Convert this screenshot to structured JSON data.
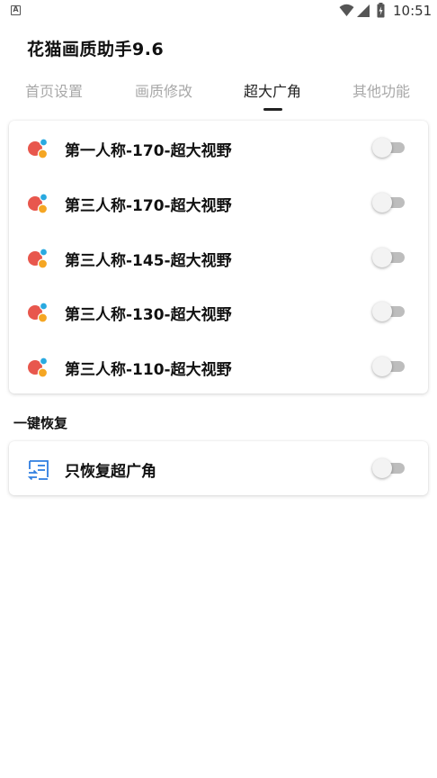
{
  "status_bar": {
    "notification_icon": "a-notification-icon",
    "wifi_icon": "wifi-icon",
    "signal_icon": "cell-signal-icon",
    "battery_icon": "battery-charging-icon",
    "time": "10:51"
  },
  "app": {
    "title": "花猫画质助手9.6"
  },
  "tabs": [
    {
      "label": "首页设置",
      "active": false
    },
    {
      "label": "画质修改",
      "active": false
    },
    {
      "label": "超大广角",
      "active": true
    },
    {
      "label": "其他功能",
      "active": false
    }
  ],
  "wide_angle": {
    "items": [
      {
        "label": "第一人称-170-超大视野",
        "icon": "palette-icon",
        "enabled": false
      },
      {
        "label": "第三人称-170-超大视野",
        "icon": "palette-icon",
        "enabled": false
      },
      {
        "label": "第三人称-145-超大视野",
        "icon": "palette-icon",
        "enabled": false
      },
      {
        "label": "第三人称-130-超大视野",
        "icon": "palette-icon",
        "enabled": false
      },
      {
        "label": "第三人称-110-超大视野",
        "icon": "palette-icon",
        "enabled": false
      }
    ]
  },
  "restore": {
    "section_label": "一键恢复",
    "items": [
      {
        "label": "只恢复超广角",
        "icon": "restore-list-icon",
        "enabled": false
      }
    ]
  },
  "colors": {
    "accent_blue": "#2f7ee0",
    "icon_red": "#e8574d",
    "icon_orange": "#f5a623",
    "icon_cyan": "#29a9e0",
    "switch_track_off": "#bdbdbd"
  }
}
